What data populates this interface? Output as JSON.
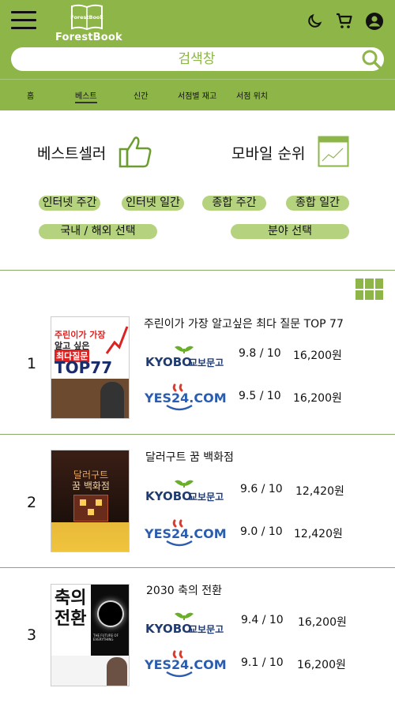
{
  "header": {
    "logo_badge": "ForestBook",
    "logo_text": "ForestBook",
    "icons": [
      "menu-icon",
      "moon-icon",
      "cart-icon",
      "account-icon"
    ]
  },
  "search": {
    "placeholder": "검색창"
  },
  "nav": {
    "tabs": [
      {
        "label": "홈"
      },
      {
        "label": "베스트"
      },
      {
        "label": "신간"
      },
      {
        "label": "서점별 재고"
      },
      {
        "label": "서점 위치"
      }
    ],
    "active": "베스트"
  },
  "sections": {
    "bestseller_title": "베스트셀러",
    "mobile_rank_title": "모바일 순위",
    "filters": {
      "internet_weekly": "인터넷 주간",
      "internet_daily": "인터넷 일간",
      "total_weekly": "종합 주간",
      "total_daily": "종합 일간",
      "domestic_foreign": "국내 / 해외 선택",
      "field_select": "분야 선택"
    }
  },
  "books": [
    {
      "rank": "1",
      "title": "주린이가 가장 알고싶은 최다 질문 TOP 77",
      "cover_lines": [
        "주린이가 가장",
        "알고 싶은",
        "최다질문",
        "TOP77"
      ],
      "kyobo": {
        "rating": "9.8 / 10",
        "price": "16,200원"
      },
      "yes24": {
        "rating": "9.5 / 10",
        "price": "16,200원"
      }
    },
    {
      "rank": "2",
      "title": "달러구트 꿈 백화점",
      "cover_lines": [
        "달러구트",
        "꿈 백화점"
      ],
      "kyobo": {
        "rating": "9.6 / 10",
        "price": "12,420원"
      },
      "yes24": {
        "rating": "9.0 / 10",
        "price": "12,420원"
      }
    },
    {
      "rank": "3",
      "title": "2030 축의 전환",
      "cover_lines": [
        "축의",
        "전환",
        "THE FUTURE OF EVERYTHING"
      ],
      "kyobo": {
        "rating": "9.4 / 10",
        "price": "16,200원"
      },
      "yes24": {
        "rating": "9.1 / 10",
        "price": "16,200원"
      }
    }
  ],
  "stores": {
    "kyobo_en": "KYOBO",
    "kyobo_ko": "교보문고",
    "yes24": "YES24.COM"
  },
  "colors": {
    "brand_green": "#8db548",
    "pill_green": "#b5d27f",
    "kyobo_navy": "#1f3b73",
    "kyobo_green": "#6aae2a",
    "yes24_blue": "#2a5db0",
    "yes24_red": "#e03a2f"
  }
}
